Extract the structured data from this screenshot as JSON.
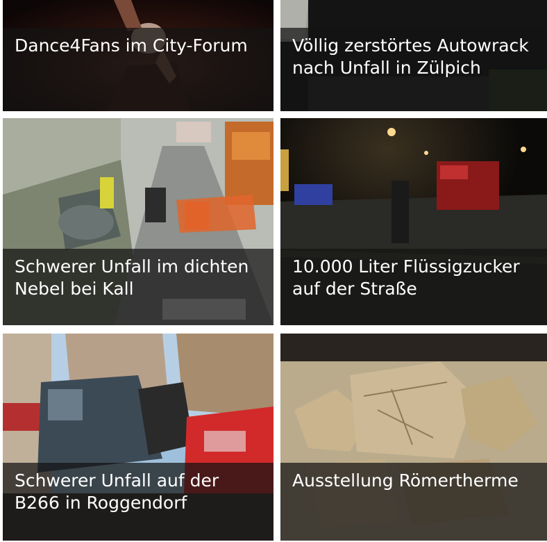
{
  "gallery": {
    "items": [
      {
        "title": "Dance4Fans im City-Forum",
        "image": "concert-photo"
      },
      {
        "title": "Völlig zerstörtes Autowrack nach Unfall in Zülpich",
        "image": "car-wreck-photo"
      },
      {
        "title": "Schwerer Unfall im dichten Nebel bei Kall",
        "image": "fog-accident-photo"
      },
      {
        "title": "10.000 Liter Flüssigzucker auf der Straße",
        "image": "firefighters-night-photo"
      },
      {
        "title": "Schwerer Unfall auf der B266 in Roggendorf",
        "image": "crash-van-photo"
      },
      {
        "title": "Ausstellung Römertherme",
        "image": "roman-stones-photo"
      }
    ]
  }
}
